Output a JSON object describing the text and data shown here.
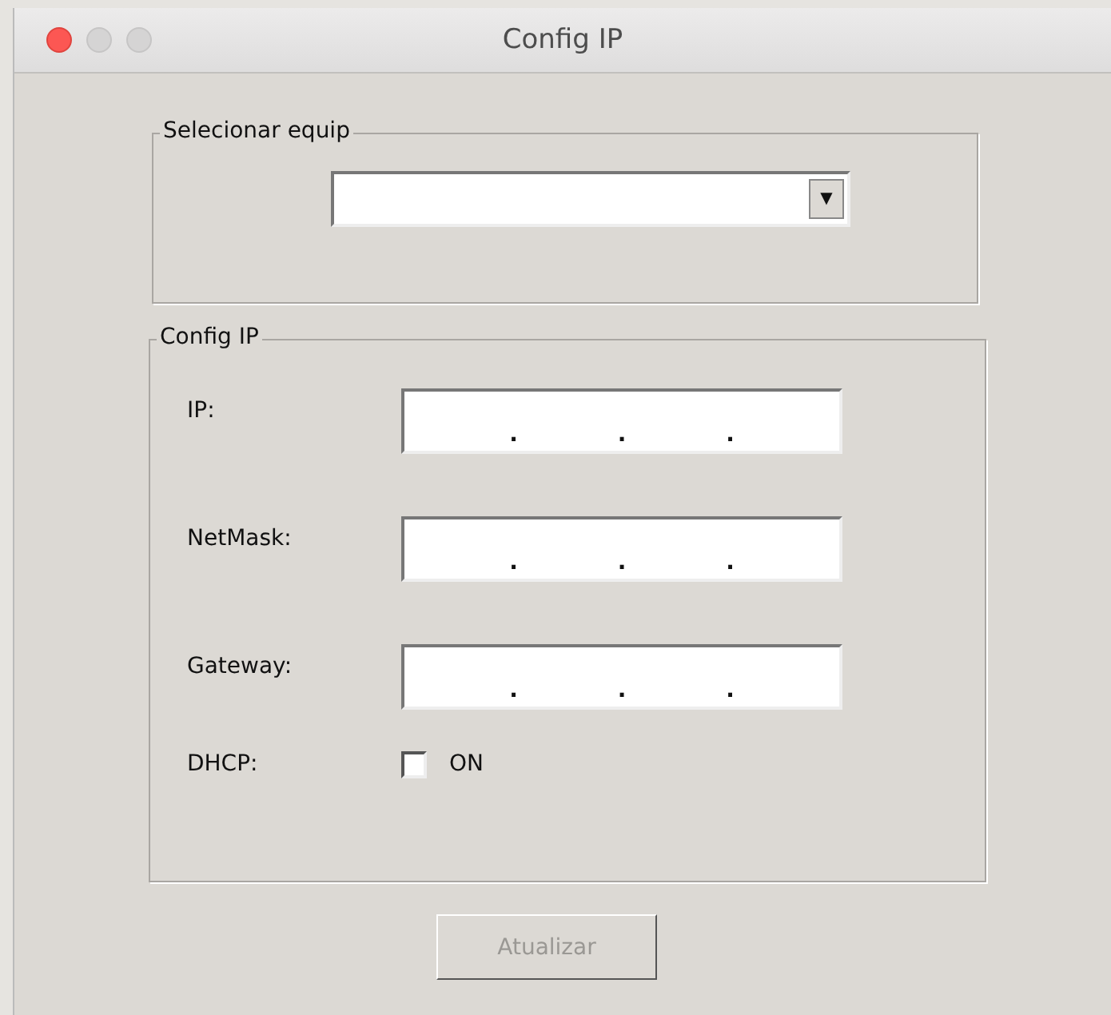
{
  "window": {
    "title": "Config IP"
  },
  "select_group": {
    "legend": "Selecionar equip",
    "dropdown": {
      "arrow": "▼"
    }
  },
  "config_group": {
    "legend": "Config IP",
    "fields": [
      {
        "label": "IP:",
        "separators": [
          ".",
          ".",
          "."
        ]
      },
      {
        "label": "NetMask:",
        "separators": [
          ".",
          ".",
          "."
        ]
      },
      {
        "label": "Gateway:",
        "separators": [
          ".",
          ".",
          "."
        ]
      }
    ],
    "dhcp": {
      "label": "DHCP:",
      "option": "ON",
      "checked": false
    }
  },
  "button": {
    "label": "Atualizar",
    "disabled": true
  }
}
